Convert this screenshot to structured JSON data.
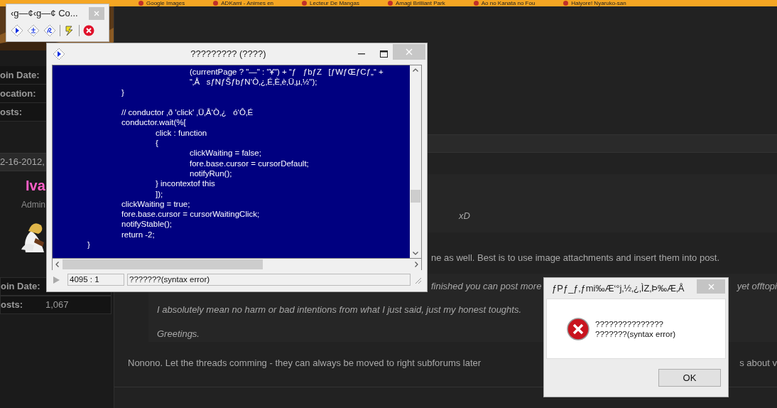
{
  "bookmarks_bar": {
    "items": [
      "Google Images",
      "ADKami - Animes en",
      "Lecteur De Mangas",
      "Amagi Brilliant Park",
      "Ao no Kanata no Fou",
      "Haiyore! Nyaruko-san"
    ]
  },
  "forum": {
    "sidebar_top": [
      {
        "label": "oin Date:"
      },
      {
        "label": "ocation:"
      },
      {
        "label": "osts:"
      }
    ],
    "post_date": "2-16-2012,",
    "username": "Iva",
    "user_title": "Admin",
    "sidebar_bottom": [
      {
        "label": "oin Date:"
      },
      {
        "label": "osts:",
        "value": "1,067"
      }
    ],
    "quote_1": "xD",
    "line_1": "ne as well. Best is to use image attachments and insert them into post.",
    "quote_2": {
      "fragment_left": "finished you can post more",
      "fragment_right": "yet offtopi",
      "lines": [
        "I absolutely mean no harm or bad intentions from what I just said, just my honest toughts.",
        "Greetings."
      ]
    },
    "reply": {
      "text": "Nonono. Let the threads comming - they can always be moved to right subforums later",
      "fragment_right": "s about v"
    }
  },
  "toolbar_window": {
    "title": "‹g—¢‹g—¢ Co..."
  },
  "code_window": {
    "title": "????????? (????)",
    "lines": [
      {
        "text": "\t\t\t\t(currentPage ? \"—\" : \"¥\") + “ƒ   ƒbƒZ   [ƒWƒŒƒCƒ„“ +",
        "gap_before": false
      },
      {
        "text": "\t\t\t\t“‚Å   sƒNƒŠƒbƒN‘Ò‚¿‚É‚È‚è‚Ü‚µ‚½\");",
        "gap_before": false
      },
      {
        "text": "\t\t}",
        "gap_before": false
      },
      {
        "text": "\t\t// conductor ‚ð 'click' ‚Ü‚Å‘Ò‚¿   ó‘Ô‚É",
        "gap_before": true
      },
      {
        "text": "\t\tconductor.wait(%[",
        "gap_before": false
      },
      {
        "text": "\t\t\tclick : function",
        "gap_before": false
      },
      {
        "text": "\t\t\t{",
        "gap_before": false
      },
      {
        "text": "\t\t\t\tclickWaiting = false;",
        "gap_before": false
      },
      {
        "text": "\t\t\t\tfore.base.cursor = cursorDefault;",
        "gap_before": false
      },
      {
        "text": "\t\t\t\tnotifyRun();",
        "gap_before": false
      },
      {
        "text": "\t\t\t} incontextof this",
        "gap_before": false
      },
      {
        "text": "\t\t\t]);",
        "gap_before": false
      },
      {
        "text": "\t\tclickWaiting = true;",
        "gap_before": false
      },
      {
        "text": "\t\tfore.base.cursor = cursorWaitingClick;",
        "gap_before": false
      },
      {
        "text": "\t\tnotifyStable();",
        "gap_before": false
      },
      {
        "text": "\t\treturn -2;",
        "gap_before": false
      },
      {
        "text": "\t}",
        "gap_before": false
      }
    ],
    "status": {
      "position": "4095 : 1",
      "message": "???????(syntax error)"
    }
  },
  "error_dialog": {
    "title": "ƒPƒ_ƒ‚ƒmi‰Æ‘°j‚½‚¿‚ÌZ‚Þ‰Æ‚Å",
    "message_lines": [
      "???????????????",
      "???????(syntax error)"
    ],
    "ok_button": "OK"
  }
}
